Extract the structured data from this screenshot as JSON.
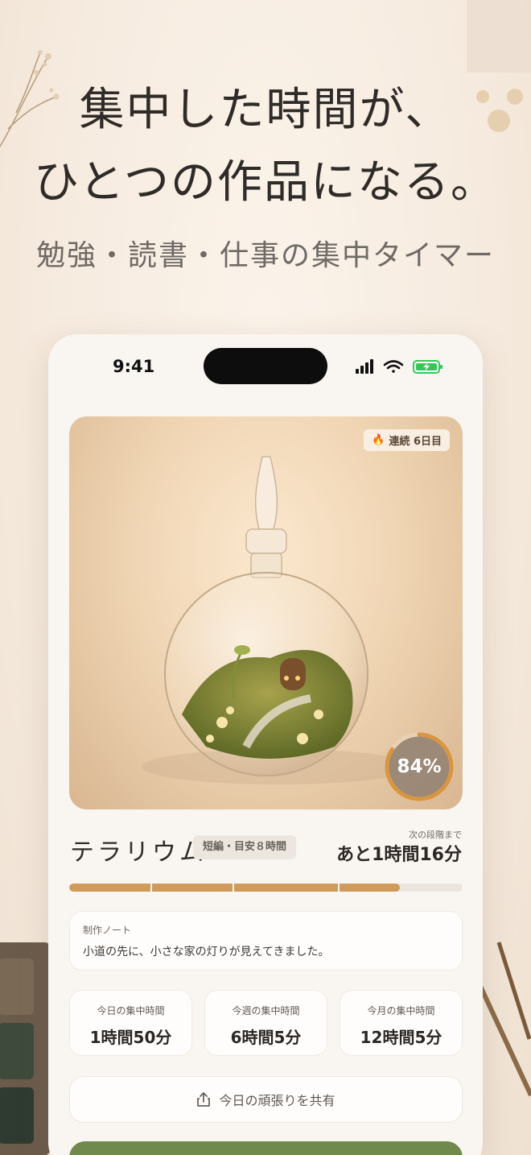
{
  "promo": {
    "headline_line1": "集中した時間が、",
    "headline_line2": "ひとつの作品になる。",
    "subheadline": "勉強・読書・仕事の集中タイマー"
  },
  "status_bar": {
    "time": "9:41",
    "icons": [
      "signal-icon",
      "wifi-icon",
      "battery-charging-icon"
    ]
  },
  "artwork": {
    "streak_label": "連続 6日目",
    "streak_icon": "flame-icon",
    "progress_percent_label": "84%",
    "progress_fraction": 0.84
  },
  "work": {
    "title": "テラリウム",
    "tag": "短編・目安８時間",
    "next_stage_label": "次の段階まで",
    "next_stage_value": "あと1時間16分",
    "progress_fraction": 0.84
  },
  "note": {
    "label": "制作ノート",
    "text": "小道の先に、小さな家の灯りが見えてきました。"
  },
  "stats": [
    {
      "label": "今日の集中時間",
      "value": "1時間50分"
    },
    {
      "label": "今週の集中時間",
      "value": "6時間5分"
    },
    {
      "label": "今月の集中時間",
      "value": "12時間5分"
    }
  ],
  "share": {
    "label": "今日の頑張りを共有",
    "icon": "share-icon"
  },
  "colors": {
    "accent_progress": "#cf9a5c",
    "cta_green": "#6f8a4c",
    "background": "#f7ede2"
  }
}
